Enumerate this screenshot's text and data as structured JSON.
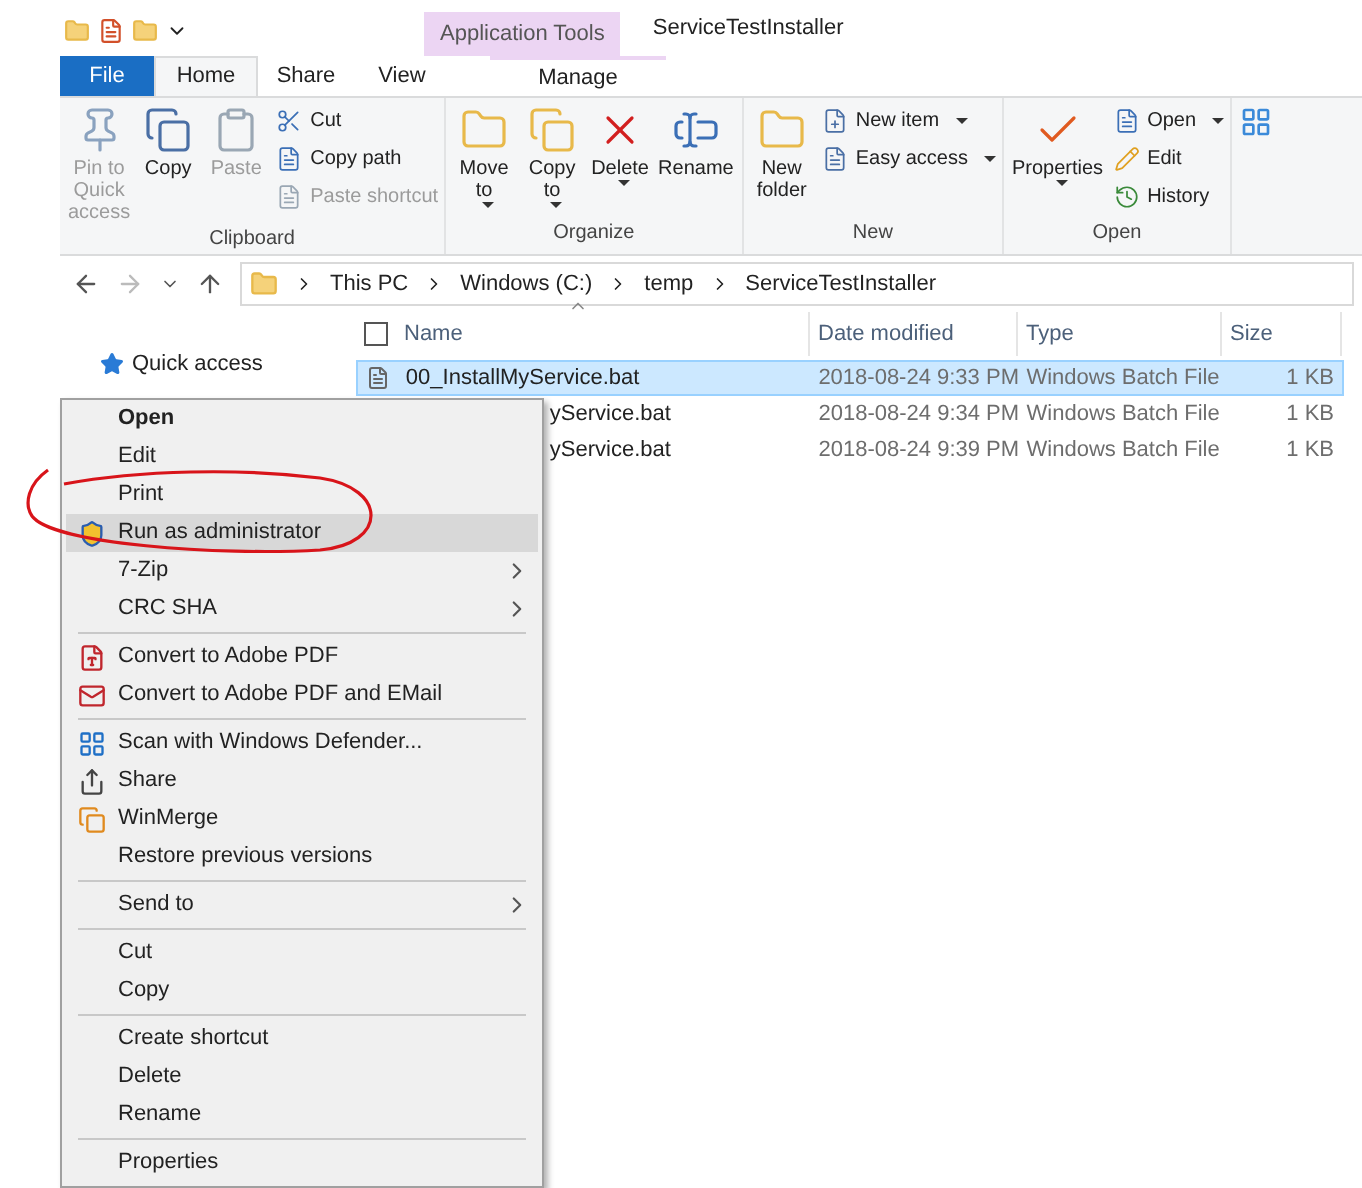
{
  "window": {
    "title": "ServiceTestInstaller",
    "context_tab": "Application Tools"
  },
  "tabs": [
    {
      "label": "File",
      "kind": "file",
      "selected": false
    },
    {
      "label": "Home",
      "kind": "tab",
      "selected": true
    },
    {
      "label": "Share",
      "kind": "tab",
      "selected": false
    },
    {
      "label": "View",
      "kind": "tab",
      "selected": false
    },
    {
      "label": "Manage",
      "kind": "context",
      "selected": false
    }
  ],
  "ribbon": [
    {
      "name": "Clipboard",
      "large": [
        {
          "label": "Pin to Quick access",
          "disabled": true,
          "dropdown": false
        },
        {
          "label": "Copy",
          "disabled": false,
          "dropdown": false
        },
        {
          "label": "Paste",
          "disabled": true,
          "dropdown": false
        }
      ],
      "small": [
        {
          "label": "Cut",
          "disabled": false,
          "dropdown": false
        },
        {
          "label": "Copy path",
          "disabled": false,
          "dropdown": false
        },
        {
          "label": "Paste shortcut",
          "disabled": true,
          "dropdown": false
        }
      ]
    },
    {
      "name": "Organize",
      "large": [
        {
          "label": "Move to",
          "disabled": false,
          "dropdown": true
        },
        {
          "label": "Copy to",
          "disabled": false,
          "dropdown": true
        },
        {
          "label": "Delete",
          "disabled": false,
          "dropdown": true
        },
        {
          "label": "Rename",
          "disabled": false,
          "dropdown": false
        }
      ]
    },
    {
      "name": "New",
      "large": [
        {
          "label": "New folder",
          "disabled": false,
          "dropdown": false
        }
      ],
      "small": [
        {
          "label": "New item",
          "disabled": false,
          "dropdown": true
        },
        {
          "label": "Easy access",
          "disabled": false,
          "dropdown": true
        }
      ]
    },
    {
      "name": "Open",
      "large": [
        {
          "label": "Properties",
          "disabled": false,
          "dropdown": true
        }
      ],
      "small": [
        {
          "label": "Open",
          "disabled": false,
          "dropdown": true
        },
        {
          "label": "Edit",
          "disabled": false,
          "dropdown": false
        },
        {
          "label": "History",
          "disabled": false,
          "dropdown": false
        }
      ]
    }
  ],
  "breadcrumb": [
    "This PC",
    "Windows (C:)",
    "temp",
    "ServiceTestInstaller"
  ],
  "nav_pane": [
    {
      "label": "Quick access"
    }
  ],
  "table": {
    "select_all": {
      "checked": false
    },
    "columns": [
      "Name",
      "Date modified",
      "Type",
      "Size"
    ],
    "rows": [
      {
        "name": "00_InstallMyService.bat",
        "covered": false,
        "date": "2018-08-24 9:33 PM",
        "type": "Windows Batch File",
        "size": "1 KB",
        "selected": true
      },
      {
        "name": "yService.bat",
        "covered": true,
        "date": "2018-08-24 9:34 PM",
        "type": "Windows Batch File",
        "size": "1 KB",
        "selected": false
      },
      {
        "name": "yService.bat",
        "covered": true,
        "date": "2018-08-24 9:39 PM",
        "type": "Windows Batch File",
        "size": "1 KB",
        "selected": false
      }
    ]
  },
  "context_menu": [
    {
      "kind": "item",
      "label": "Open",
      "default": true,
      "selected": false,
      "submenu": false
    },
    {
      "kind": "item",
      "label": "Edit",
      "default": false,
      "selected": false,
      "submenu": false
    },
    {
      "kind": "item",
      "label": "Print",
      "default": false,
      "selected": false,
      "submenu": false
    },
    {
      "kind": "item",
      "label": "Run as administrator",
      "default": false,
      "selected": true,
      "submenu": false
    },
    {
      "kind": "item",
      "label": "7-Zip",
      "default": false,
      "selected": false,
      "submenu": true
    },
    {
      "kind": "item",
      "label": "CRC SHA",
      "default": false,
      "selected": false,
      "submenu": true
    },
    {
      "kind": "separator"
    },
    {
      "kind": "item",
      "label": "Convert to Adobe PDF",
      "default": false,
      "selected": false,
      "submenu": false
    },
    {
      "kind": "item",
      "label": "Convert to Adobe PDF and EMail",
      "default": false,
      "selected": false,
      "submenu": false
    },
    {
      "kind": "separator"
    },
    {
      "kind": "item",
      "label": "Scan with Windows Defender...",
      "default": false,
      "selected": false,
      "submenu": false
    },
    {
      "kind": "item",
      "label": "Share",
      "default": false,
      "selected": false,
      "submenu": false
    },
    {
      "kind": "item",
      "label": "WinMerge",
      "default": false,
      "selected": false,
      "submenu": false
    },
    {
      "kind": "item",
      "label": "Restore previous versions",
      "default": false,
      "selected": false,
      "submenu": false
    },
    {
      "kind": "separator"
    },
    {
      "kind": "item",
      "label": "Send to",
      "default": false,
      "selected": false,
      "submenu": true
    },
    {
      "kind": "separator"
    },
    {
      "kind": "item",
      "label": "Cut",
      "default": false,
      "selected": false,
      "submenu": false
    },
    {
      "kind": "item",
      "label": "Copy",
      "default": false,
      "selected": false,
      "submenu": false
    },
    {
      "kind": "separator"
    },
    {
      "kind": "item",
      "label": "Create shortcut",
      "default": false,
      "selected": false,
      "submenu": false
    },
    {
      "kind": "item",
      "label": "Delete",
      "default": false,
      "selected": false,
      "submenu": false
    },
    {
      "kind": "item",
      "label": "Rename",
      "default": false,
      "selected": false,
      "submenu": false
    },
    {
      "kind": "separator"
    },
    {
      "kind": "item",
      "label": "Properties",
      "default": false,
      "selected": false,
      "submenu": false
    }
  ]
}
